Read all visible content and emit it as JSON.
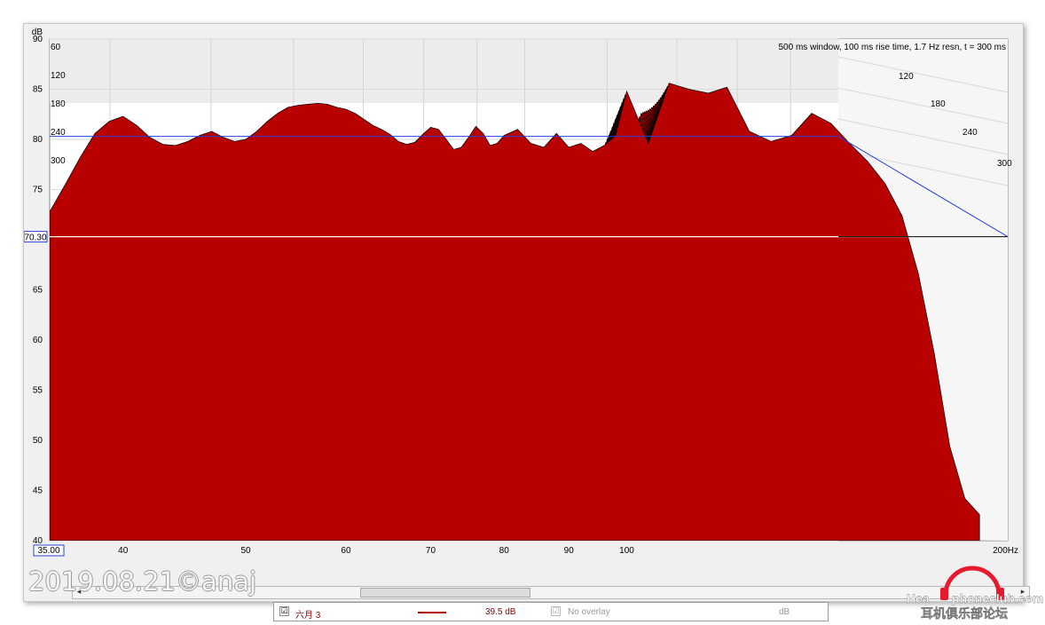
{
  "chart_data": {
    "type": "waterfall",
    "title": "",
    "ylabel": "dB",
    "xlabel": "",
    "x_unit": "Hz",
    "ylim": [
      40,
      90
    ],
    "xlim": [
      35,
      200
    ],
    "x_log_scale": true,
    "y_ticks": [
      40,
      45,
      50,
      55,
      60,
      65,
      75,
      80,
      85,
      90
    ],
    "x_ticks": [
      40,
      50,
      60,
      70,
      80,
      90,
      100
    ],
    "x_start_label": "35.00",
    "x_end_label": "200Hz",
    "y_cursor_label": "70.30",
    "y_cursor_value": 70.3,
    "time_ticks": [
      "60",
      "120",
      "180",
      "240",
      "300"
    ],
    "time_ticks_side": [
      "120",
      "180",
      "240",
      "300"
    ],
    "time_max_ms": 300,
    "settings_text": "500 ms window, 100 ms rise time,  1.7 Hz resn, t = 300 ms",
    "fill_color": "#b80000",
    "line_color": "#000000",
    "front_slice": {
      "freq_hz": [
        35,
        36,
        37,
        38,
        39,
        40,
        41,
        42,
        43,
        44,
        45,
        46,
        47,
        48,
        49,
        50,
        51,
        52,
        53,
        54,
        55,
        56,
        57,
        58,
        59,
        60,
        61,
        62,
        63,
        64,
        65,
        66,
        67,
        68,
        69,
        70,
        71,
        72,
        73,
        74,
        75,
        76,
        77,
        78,
        79,
        80,
        82,
        84,
        86,
        88,
        90,
        92,
        94,
        96,
        98,
        100,
        104,
        108,
        112,
        116,
        120,
        125,
        130,
        135,
        140,
        145,
        150,
        155,
        160,
        165,
        170,
        175,
        180,
        185,
        190
      ],
      "level_db": [
        72.8,
        75.5,
        78.2,
        80.6,
        81.8,
        82.3,
        81.4,
        80.2,
        79.5,
        79.4,
        79.8,
        80.4,
        80.8,
        80.2,
        79.8,
        80.0,
        80.8,
        81.8,
        82.6,
        83.2,
        83.4,
        83.5,
        83.6,
        83.5,
        83.2,
        83.0,
        82.6,
        82.0,
        81.4,
        81.0,
        80.5,
        79.8,
        79.5,
        79.7,
        80.5,
        81.2,
        81.0,
        80.0,
        79.0,
        79.2,
        80.2,
        81.3,
        80.6,
        79.4,
        79.6,
        80.4,
        81.0,
        79.6,
        79.2,
        80.6,
        79.2,
        79.6,
        78.8,
        79.4,
        80.4,
        84.8,
        79.6,
        85.6,
        85.0,
        84.6,
        85.2,
        80.8,
        79.8,
        80.4,
        82.6,
        81.6,
        79.6,
        77.8,
        75.6,
        72.4,
        66.6,
        58.6,
        49.4,
        44.2,
        42.6
      ]
    }
  },
  "legend": {
    "checkbox1_mark": "☑",
    "name": "六月 3",
    "value": "39.5 dB",
    "checkbox2_mark": "☑",
    "overlay": "No overlay",
    "unit": "dB"
  },
  "scrollbar": {
    "left_arrow": "◂",
    "right_arrow": "▸"
  },
  "watermark": {
    "date_text": "2019.08.21©anaj",
    "site_prefix": "Hea",
    "site_suffix": "phoneclub.com",
    "cn_text": "耳机俱乐部论坛"
  }
}
